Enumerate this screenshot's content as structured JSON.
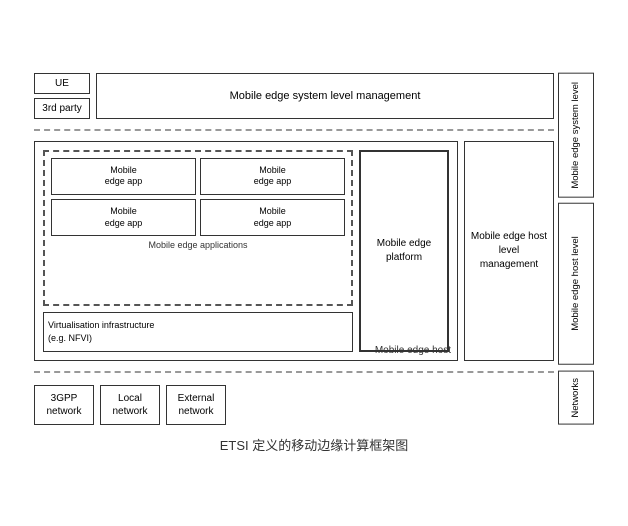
{
  "diagram": {
    "title": "ETSI 定义的移动边缘计算框架图",
    "ue_label": "UE",
    "third_party_label": "3rd party",
    "system_mgmt_label": "Mobile edge system level management",
    "right_label_system": "Mobile edge system level",
    "right_label_host": "Mobile edge host level",
    "right_label_networks": "Networks",
    "host_box_label": "Mobile edge host",
    "apps": [
      {
        "label": "Mobile\nedge app"
      },
      {
        "label": "Mobile\nedge app"
      },
      {
        "label": "Mobile\nedge app"
      },
      {
        "label": "Mobile\nedge app"
      }
    ],
    "apps_section_label": "Mobile edge applications",
    "virt_label": "Virtualisation infrastructure\n(e.g. NFVI)",
    "platform_label": "Mobile edge platform",
    "host_mgmt_label": "Mobile edge host level management",
    "networks": [
      {
        "label": "3GPP\nnetwork"
      },
      {
        "label": "Local\nnetwork"
      },
      {
        "label": "External\nnetwork"
      }
    ]
  }
}
